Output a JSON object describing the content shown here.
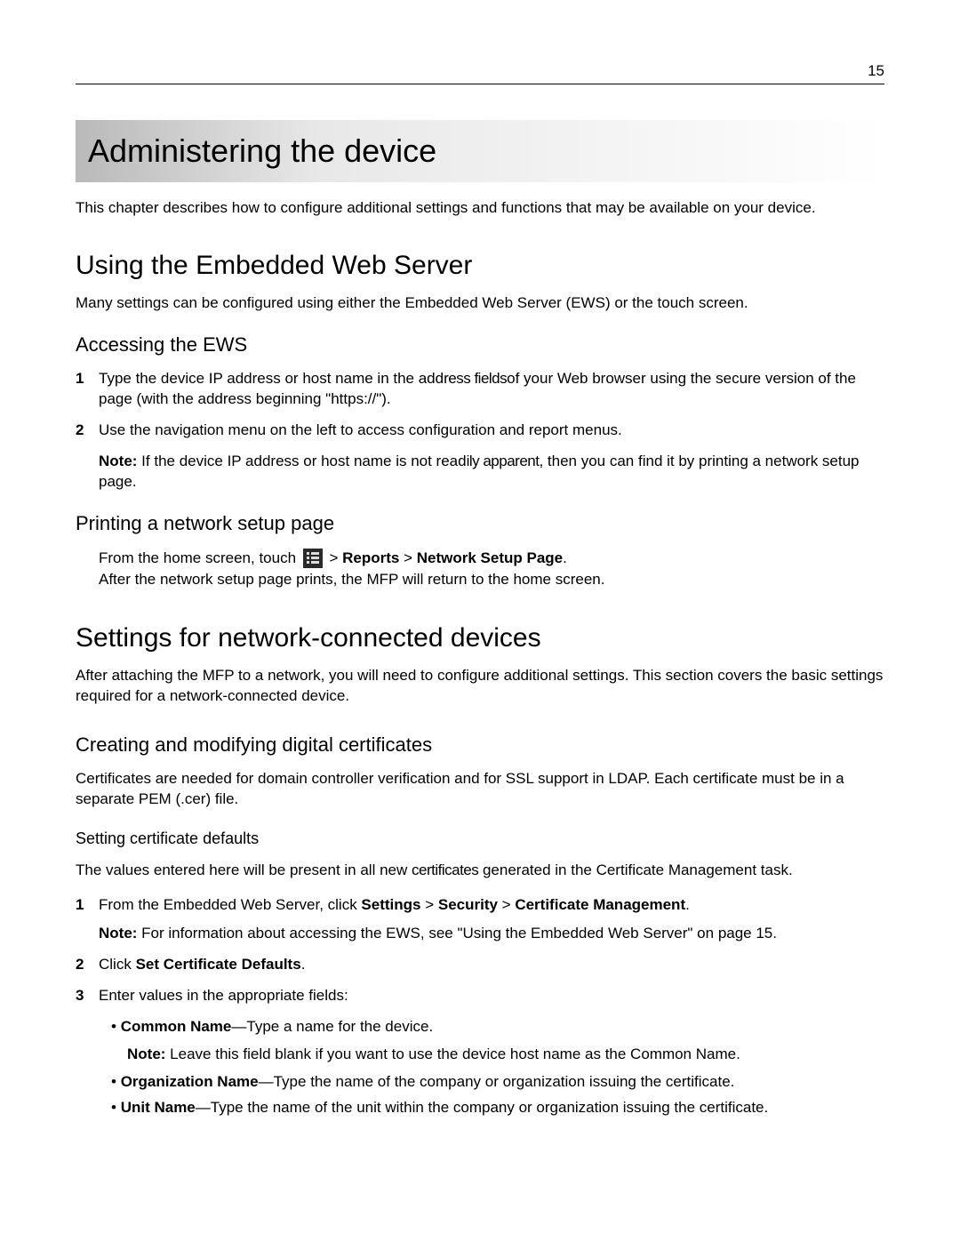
{
  "page_number": "15",
  "chapter_title": "Administering the device",
  "chapter_intro": "This chapter describes how to configure additional settings and functions that may be available on your device.",
  "section1": {
    "title": "Using the Embedded Web Server",
    "body": "Many settings can be configured using either the Embedded Web Server (EWS) or the touch screen.",
    "sub1": {
      "title": "Accessing the EWS",
      "step1_num": "1",
      "step1_pre": "Type the device IP address or host name in the add",
      "step1_overlap": "ress fields",
      "step1_post": "of your Web browser using the secure version of the page (with the address beginning \"https://\").",
      "step2_num": "2",
      "step2": "Use the navigation menu on the left to access configuration and report menus.",
      "note_label": "Note:",
      "note_pre": " If the device IP address or host name is not read",
      "note_overlap": "ily apparent",
      "note_post": ", then you can find it by printing a network setup page."
    },
    "sub2": {
      "title": "Printing a network setup page",
      "line_pre": "From the home screen, touch ",
      "line_post1": " > ",
      "line_reports": "Reports",
      "line_post2": " > ",
      "line_nsp": "Network Setup Page",
      "line_post3": ".",
      "line2": "After the network setup page prints, the MFP will return to the home screen."
    }
  },
  "section2": {
    "title": "Settings for network-connected devices",
    "body": "After attaching the MFP to a network, you will need to configure additional settings. This section covers the basic settings required for a network-connected device.",
    "sub1": {
      "title": "Creating and modifying digital certificates",
      "body": "Certificates are needed for domain controller verification and for SSL support in LDAP. Each certificate must be in a separate PEM (.cer) file.",
      "sub_a": {
        "title": "Setting certificate defaults",
        "body_pre": "The values entered here will be present in all new ",
        "body_overlap": "certificates",
        "body_post": " generated in the Certificate Management task.",
        "step1_num": "1",
        "step1_pre": "From the Embedded Web Server, click ",
        "step1_bold1": "Settings",
        "step1_g1": " > ",
        "step1_bold2": "Security",
        "step1_g2": " > ",
        "step1_bold3": "Certificate Management",
        "step1_post": ".",
        "step1_note_label": "Note:",
        "step1_note": " For information about accessing the EWS, see \"Using the Embedded Web Server\" on page 15.",
        "step2_num": "2",
        "step2_pre": "Click ",
        "step2_bold": "Set Certificate Defaults",
        "step2_post": ".",
        "step3_num": "3",
        "step3": "Enter values in the appropriate fields:",
        "f1_bold": "Common Name",
        "f1_dash": "—",
        "f1_text": "Type a name for the device.",
        "f1_note_label": "Note:",
        "f1_note": " Leave this field blank if you want to use the device host name as the Common Name.",
        "f2_bold": "Organization Name",
        "f2_dash": "—",
        "f2_text": "Type the name of the company or organization issuing the certificate.",
        "f3_bold": "Unit Name",
        "f3_dash": "—",
        "f3_text": "Type the name of the unit within the company or organization issuing the certificate."
      }
    }
  }
}
